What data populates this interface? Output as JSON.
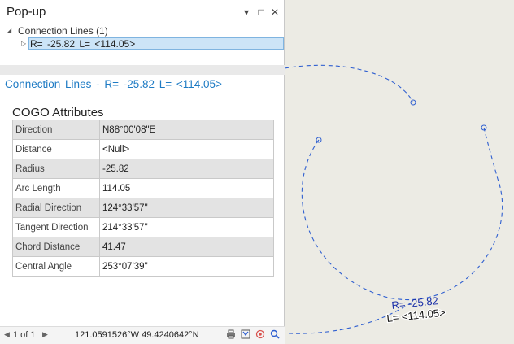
{
  "popup": {
    "title": "Pop-up",
    "controls": {
      "menu": "▾",
      "maximize": "□",
      "close": "✕"
    },
    "tree": {
      "group_label": "Connection Lines (1)",
      "group_arrow": "◢",
      "item_arrow": "▷",
      "item_label": "R= -25.82   L= <114.05>"
    },
    "feature_title": "Connection Lines - R= -25.82   L= <114.05>",
    "section_title": "COGO Attributes",
    "attributes": [
      {
        "key": "Direction",
        "value": "N88°00'08\"E"
      },
      {
        "key": "Distance",
        "value": "<Null>"
      },
      {
        "key": "Radius",
        "value": "-25.82"
      },
      {
        "key": "Arc Length",
        "value": "114.05"
      },
      {
        "key": "Radial Direction",
        "value": "124°33'57\""
      },
      {
        "key": "Tangent Direction",
        "value": "214°33'57\""
      },
      {
        "key": "Chord Distance",
        "value": "41.47"
      },
      {
        "key": "Central Angle",
        "value": "253°07'39\""
      }
    ],
    "status": {
      "prev": "◀",
      "next": "▶",
      "count": "1 of 1",
      "coordinates": "121.0591526°W 49.4240642°N",
      "icons": [
        "printer-icon",
        "zoom-to-icon",
        "flash-icon",
        "pan-to-icon"
      ]
    }
  },
  "map": {
    "arc_label_radius": "R= -25.82",
    "arc_label_length": "L= <114.05>",
    "colors": {
      "arc": "#2f5fd0",
      "background": "#ecebe4",
      "label_r": "#1a2fa8",
      "label_l": "#111111"
    }
  }
}
